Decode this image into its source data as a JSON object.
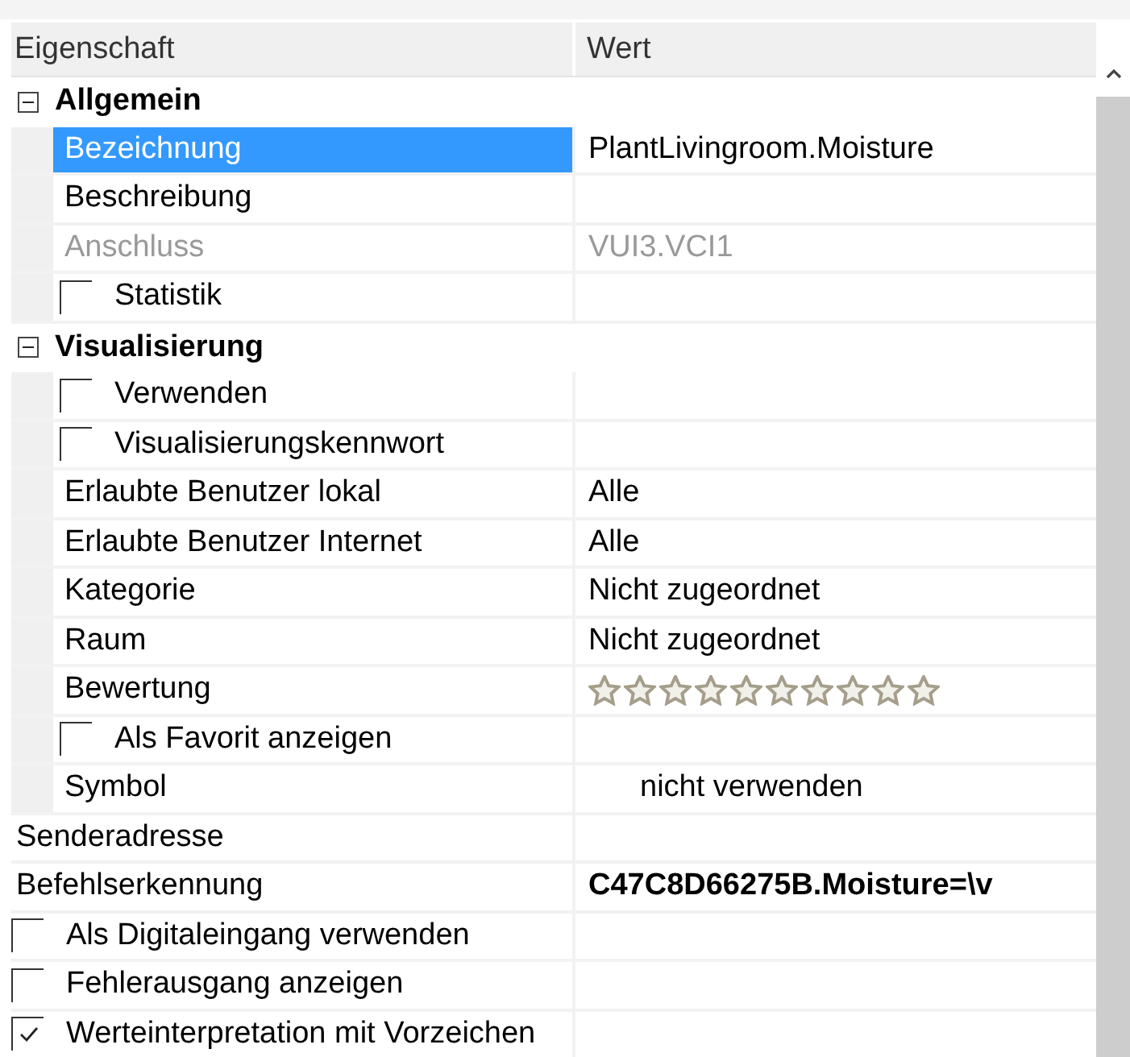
{
  "header": {
    "columns": [
      "Eigenschaft",
      "Wert"
    ]
  },
  "rows": [
    {
      "kind": "group",
      "label": "Allgemein",
      "expanded": true,
      "children": [
        {
          "kind": "property",
          "label": "Bezeichnung",
          "value": "PlantLivingroom.Moisture",
          "selected": true,
          "disabled": false,
          "bold": false
        },
        {
          "kind": "property",
          "label": "Beschreibung",
          "selected": false,
          "disabled": false
        },
        {
          "kind": "property",
          "label": "Anschluss",
          "value": "VUI3.VCI1",
          "selected": false,
          "disabled": true,
          "bold": false
        },
        {
          "kind": "checkbox",
          "label": "Statistik",
          "checked": false
        }
      ]
    },
    {
      "kind": "group",
      "label": "Visualisierung",
      "expanded": true,
      "children": [
        {
          "kind": "checkbox",
          "label": "Verwenden",
          "checked": false
        },
        {
          "kind": "checkbox",
          "label": "Visualisierungskennwort",
          "checked": false
        },
        {
          "kind": "property",
          "label": "Erlaubte Benutzer lokal",
          "value": "Alle",
          "selected": false,
          "disabled": false,
          "bold": false
        },
        {
          "kind": "property",
          "label": "Erlaubte Benutzer Internet",
          "value": "Alle",
          "selected": false,
          "disabled": false,
          "bold": false
        },
        {
          "kind": "property",
          "label": "Kategorie",
          "value": "Nicht zugeordnet",
          "selected": false,
          "disabled": false,
          "bold": false
        },
        {
          "kind": "property",
          "label": "Raum",
          "value": "Nicht zugeordnet",
          "selected": false,
          "disabled": false,
          "bold": false
        },
        {
          "kind": "rating",
          "label": "Bewertung",
          "stars": 0
        },
        {
          "kind": "checkbox",
          "label": "Als Favorit anzeigen",
          "checked": false
        },
        {
          "kind": "symbol",
          "label": "Symbol",
          "value": "nicht verwenden"
        }
      ]
    },
    {
      "kind": "property",
      "label": "Senderadresse",
      "selected": false,
      "disabled": false
    },
    {
      "kind": "property",
      "label": "Befehlserkennung",
      "value": "C47C8D66275B.Moisture=\\v",
      "selected": false,
      "disabled": false,
      "bold": true
    },
    {
      "kind": "checkbox",
      "label": "Als Digitaleingang verwenden",
      "checked": false
    },
    {
      "kind": "checkbox",
      "label": "Fehlerausgang anzeigen",
      "checked": false
    },
    {
      "kind": "checkbox",
      "label": "Werteinterpretation mit Vorzeichen",
      "checked": true
    }
  ]
}
